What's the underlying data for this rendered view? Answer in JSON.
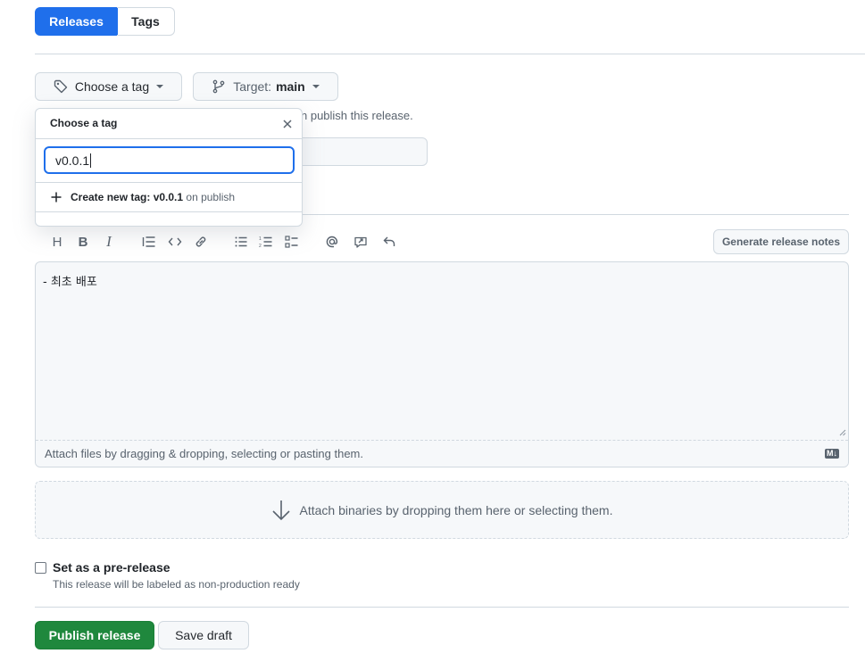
{
  "tabs": {
    "releases_label": "Releases",
    "tags_label": "Tags"
  },
  "tag_picker": {
    "button_label": "Choose a tag",
    "target_prefix": "Target:",
    "target_branch": "main",
    "partial_hint": "n publish this release."
  },
  "tag_dropdown": {
    "title": "Choose a tag",
    "filter_value": "v0.0.1",
    "create_prefix": "Create new tag: v0.0.1",
    "create_suffix": " on publish"
  },
  "editor": {
    "generate_notes_label": "Generate release notes",
    "body_text": "- 최초 배포",
    "attach_hint": "Attach files by dragging & dropping, selecting or pasting them.",
    "markdown_badge": "M↓"
  },
  "binaries": {
    "hint": "Attach binaries by dropping them here or selecting them."
  },
  "prerelease": {
    "label": "Set as a pre-release",
    "description": "This release will be labeled as non-production ready",
    "checked": false
  },
  "actions": {
    "publish_label": "Publish release",
    "save_draft_label": "Save draft"
  },
  "colors": {
    "primary_blue": "#1f6feb",
    "publish_green": "#1f883d",
    "border": "#d1d9e0"
  }
}
